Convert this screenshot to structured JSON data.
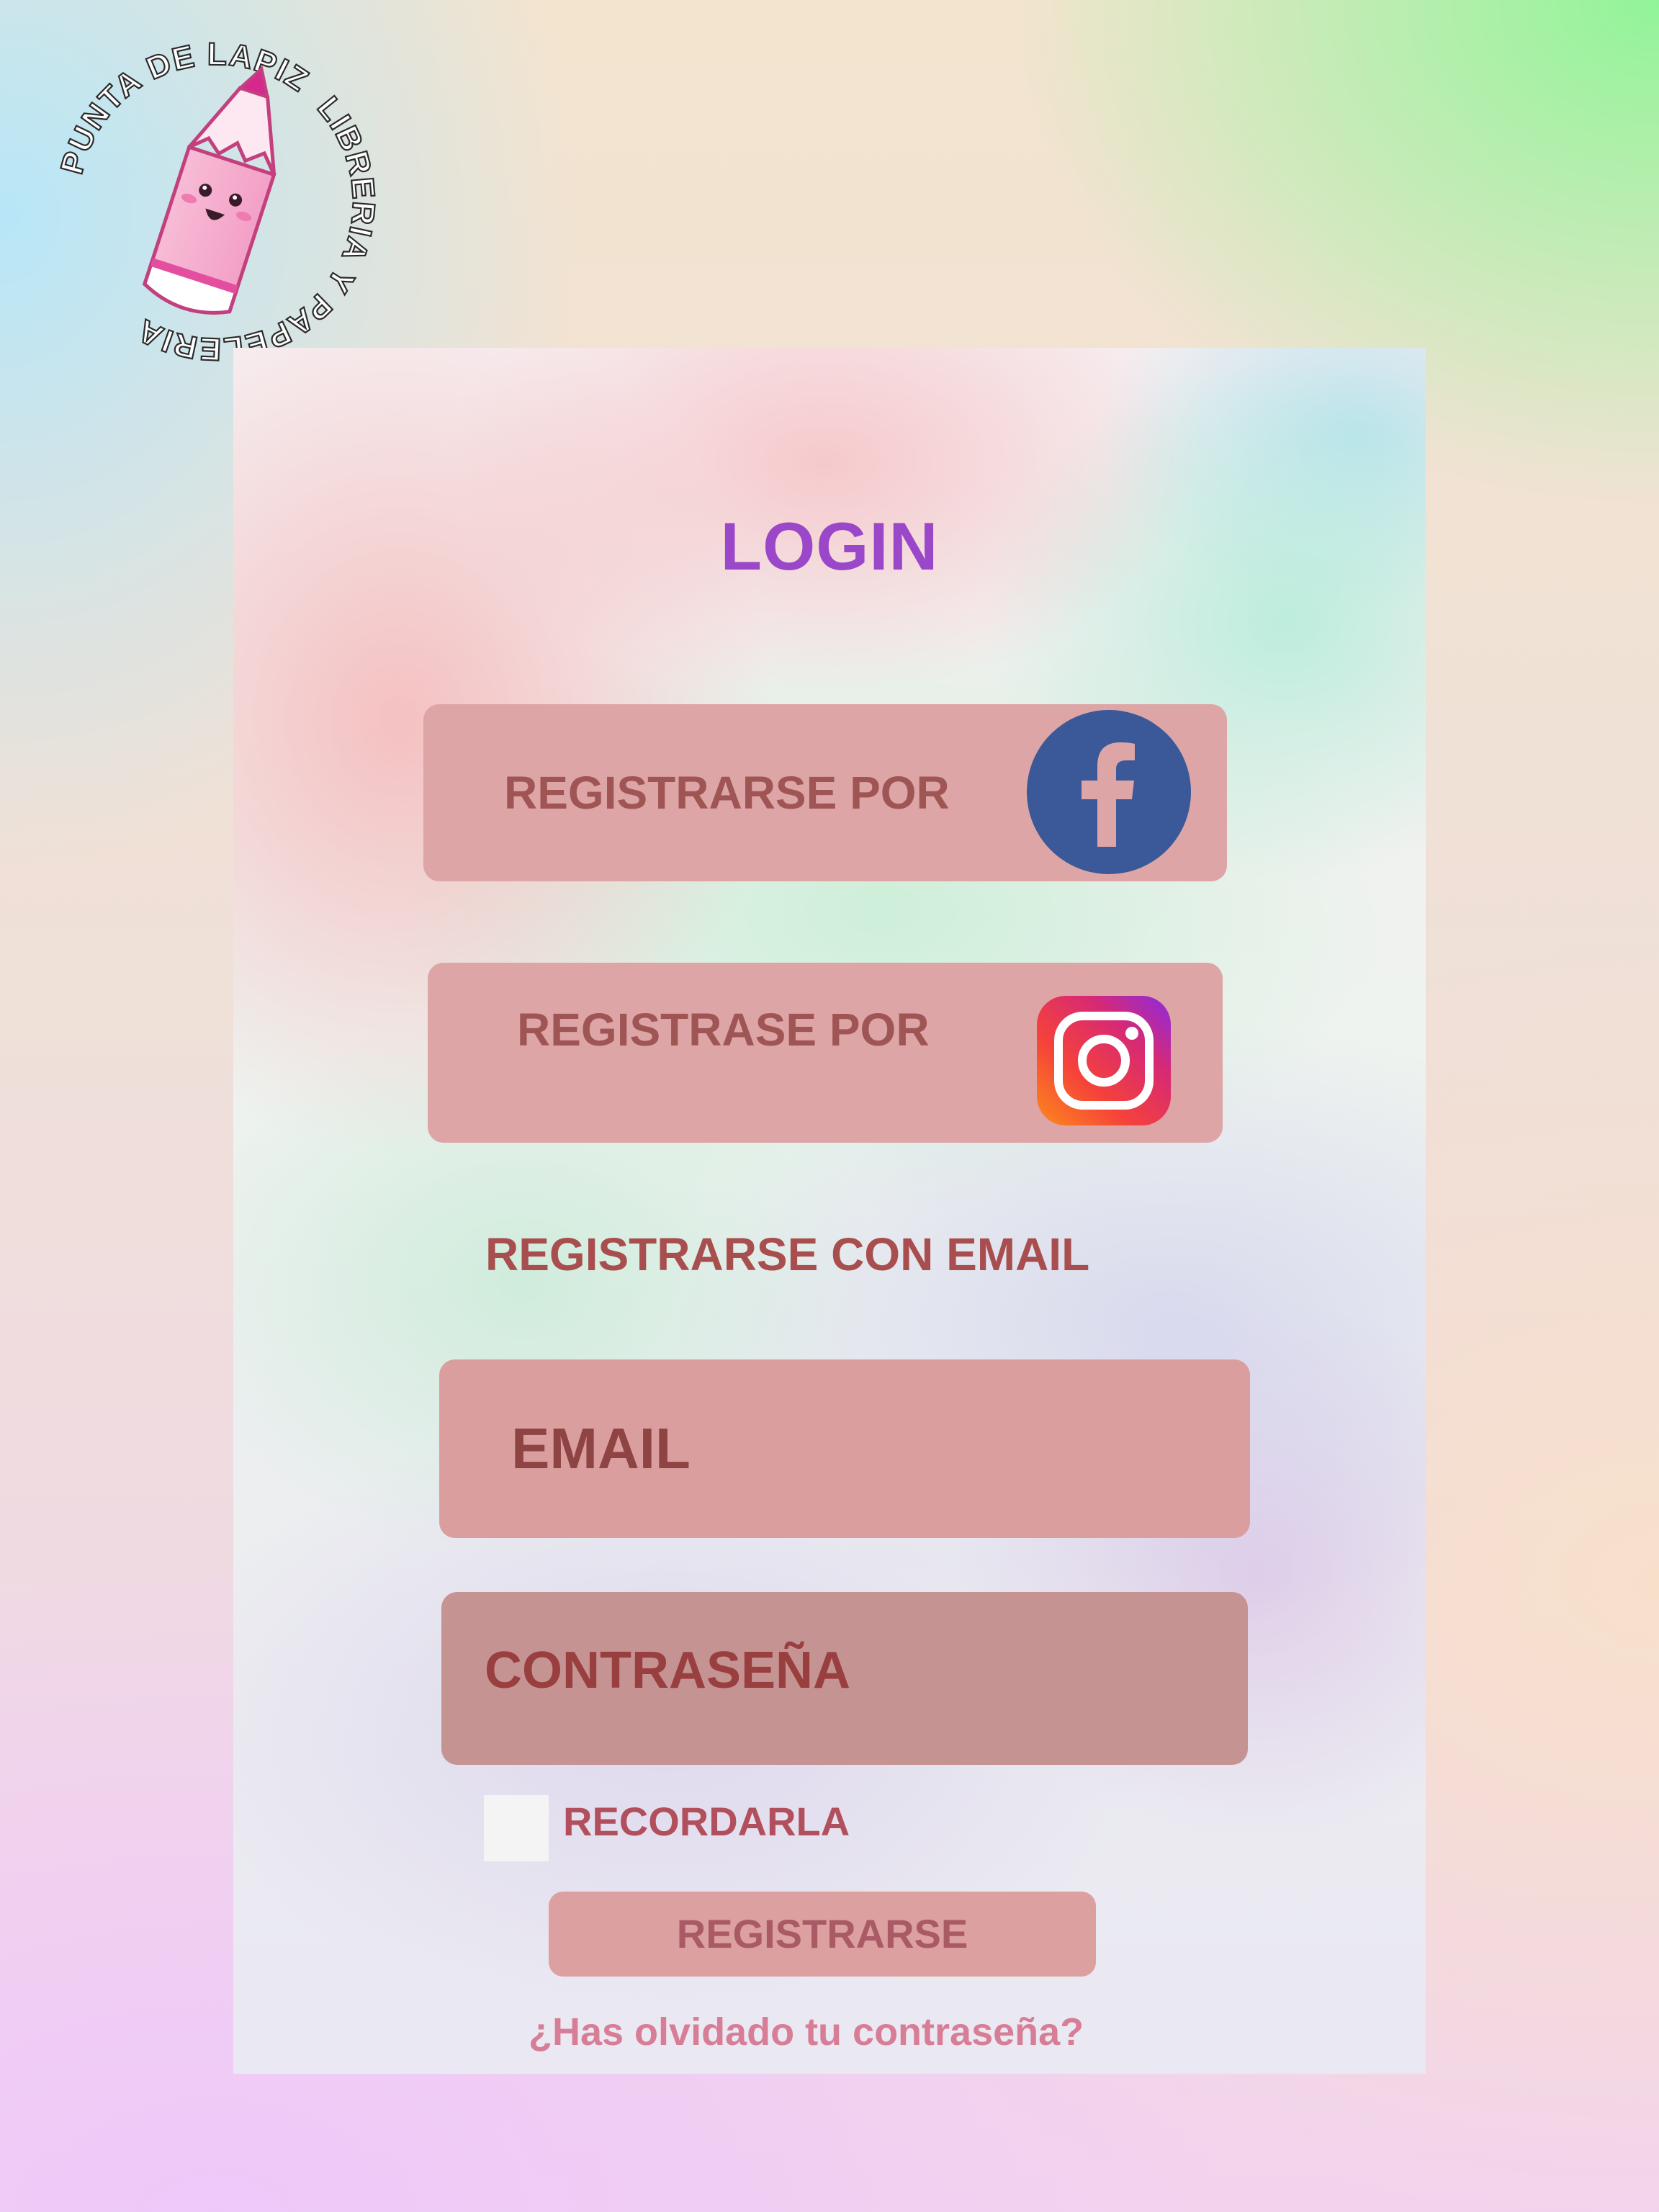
{
  "logo": {
    "ring_text_top": "PUNTA DE LAPIZ",
    "ring_text_right": "LIBRERIA Y PAPELERIA",
    "icon": "pencil-mascot-icon"
  },
  "login": {
    "title": "LOGIN",
    "facebook_button_label": "REGISTRARSE POR",
    "facebook_icon": "facebook-icon",
    "instagram_button_label": "REGISTRASE POR",
    "instagram_icon": "instagram-icon",
    "email_section_title": "REGISTRARSE CON EMAIL",
    "email_placeholder": "EMAIL",
    "password_placeholder": "CONTRASEÑA",
    "remember_label": "RECORDARLA",
    "remember_checked": false,
    "register_button_label": "REGISTRARSE",
    "forgot_link": "¿Has olvidado tu contraseña?"
  },
  "colors": {
    "title": "#9b47c9",
    "button_bg": "#dda5a6",
    "button_text": "#a05555",
    "facebook_blue": "#3b5998",
    "forgot_link": "#d77e96"
  }
}
